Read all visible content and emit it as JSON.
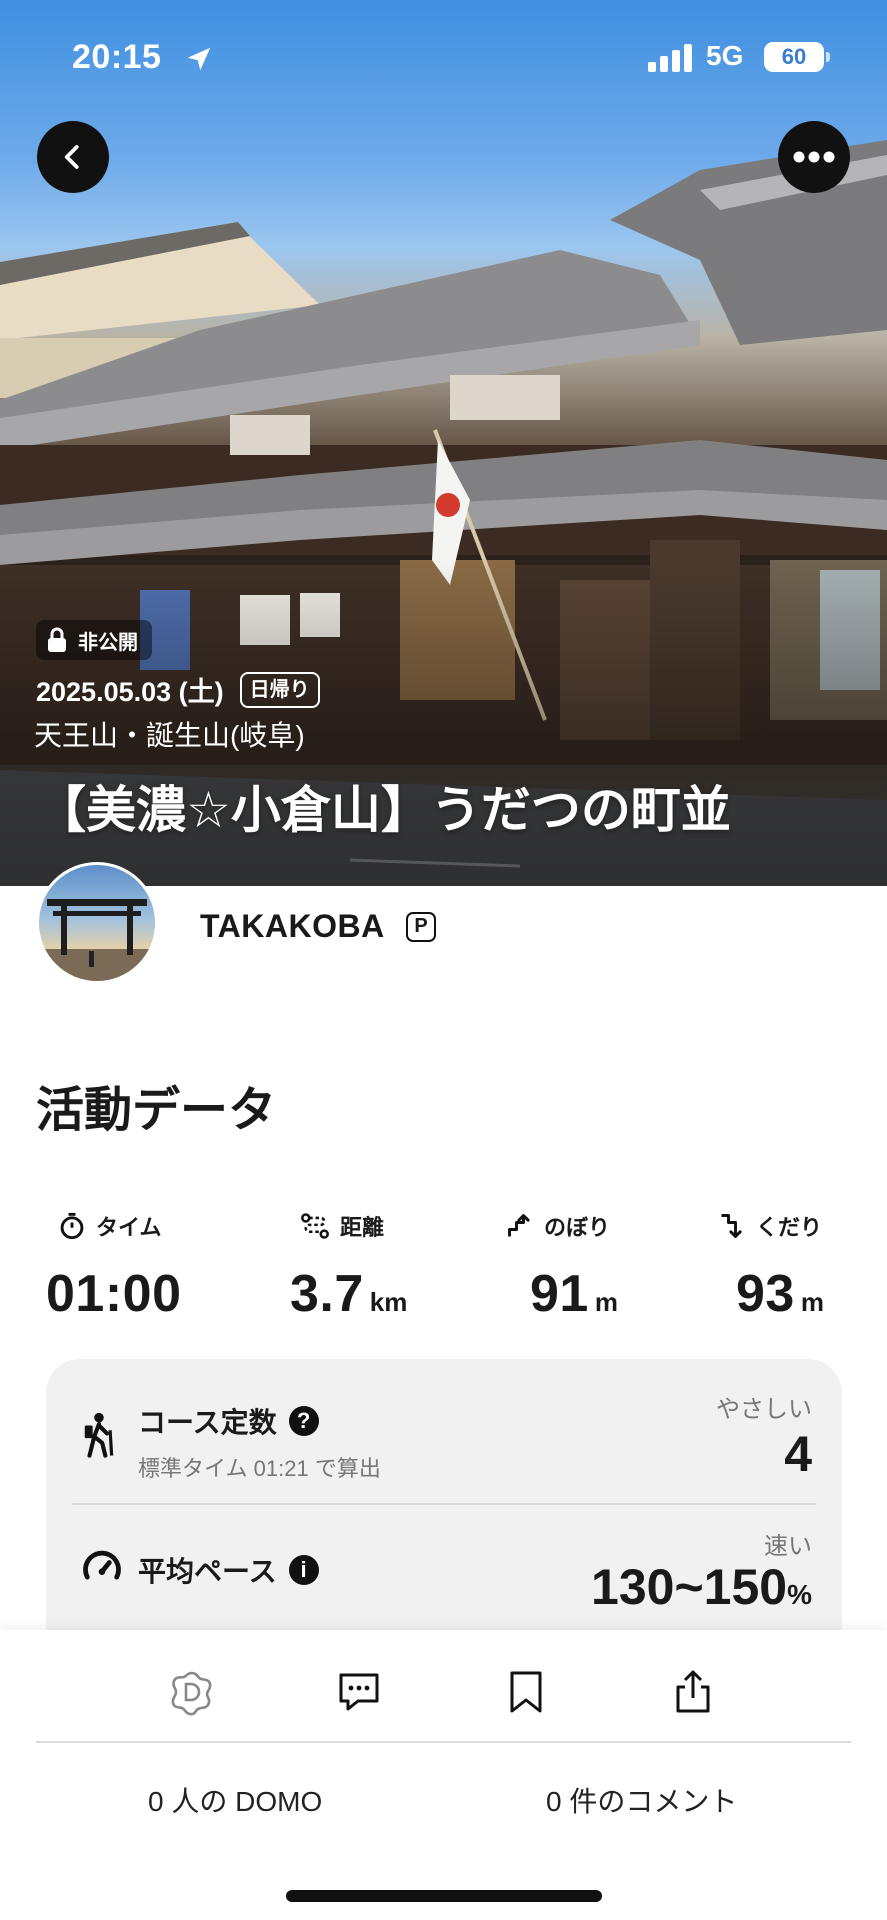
{
  "status_bar": {
    "time": "20:15",
    "network": "5G",
    "battery": "60"
  },
  "hero": {
    "private_label": "非公開",
    "date": "2025.05.03 (土)",
    "day_trip_label": "日帰り",
    "area": "天王山・誕生山(岐阜)",
    "title": "【美濃☆小倉山】うだつの町並"
  },
  "user": {
    "name": "TAKAKOBA",
    "badge": "P"
  },
  "activity": {
    "section_title": "活動データ",
    "stats": {
      "time": {
        "label": "タイム",
        "value": "01:00",
        "unit": ""
      },
      "distance": {
        "label": "距離",
        "value": "3.7",
        "unit": "km"
      },
      "ascent": {
        "label": "のぼり",
        "value": "91",
        "unit": "m"
      },
      "descent": {
        "label": "くだり",
        "value": "93",
        "unit": "m"
      }
    },
    "course_constant": {
      "label": "コース定数",
      "help_icon": "?",
      "sub": "標準タイム 01:21 で算出",
      "rating": "やさしい",
      "value": "4"
    },
    "average_pace": {
      "label": "平均ペース",
      "info_icon": "i",
      "rating": "速い",
      "value": "130~150",
      "unit": "%"
    }
  },
  "actions": {
    "domo_count": "0 人の DOMO",
    "comment_count": "0 件のコメント"
  },
  "colors": {
    "text": "#1a1a1a",
    "card_bg": "#f1f1f1",
    "subtle_text": "#777777",
    "battery_text": "#3a7dd0"
  },
  "icons": [
    "location-arrow-icon",
    "signal-icon",
    "back-chevron-icon",
    "more-dots-icon",
    "lock-icon",
    "stopwatch-icon",
    "route-icon",
    "ascent-icon",
    "descent-icon",
    "hiker-icon",
    "question-icon",
    "speedometer-icon",
    "info-icon",
    "domo-icon",
    "comment-icon",
    "bookmark-icon",
    "share-icon"
  ]
}
